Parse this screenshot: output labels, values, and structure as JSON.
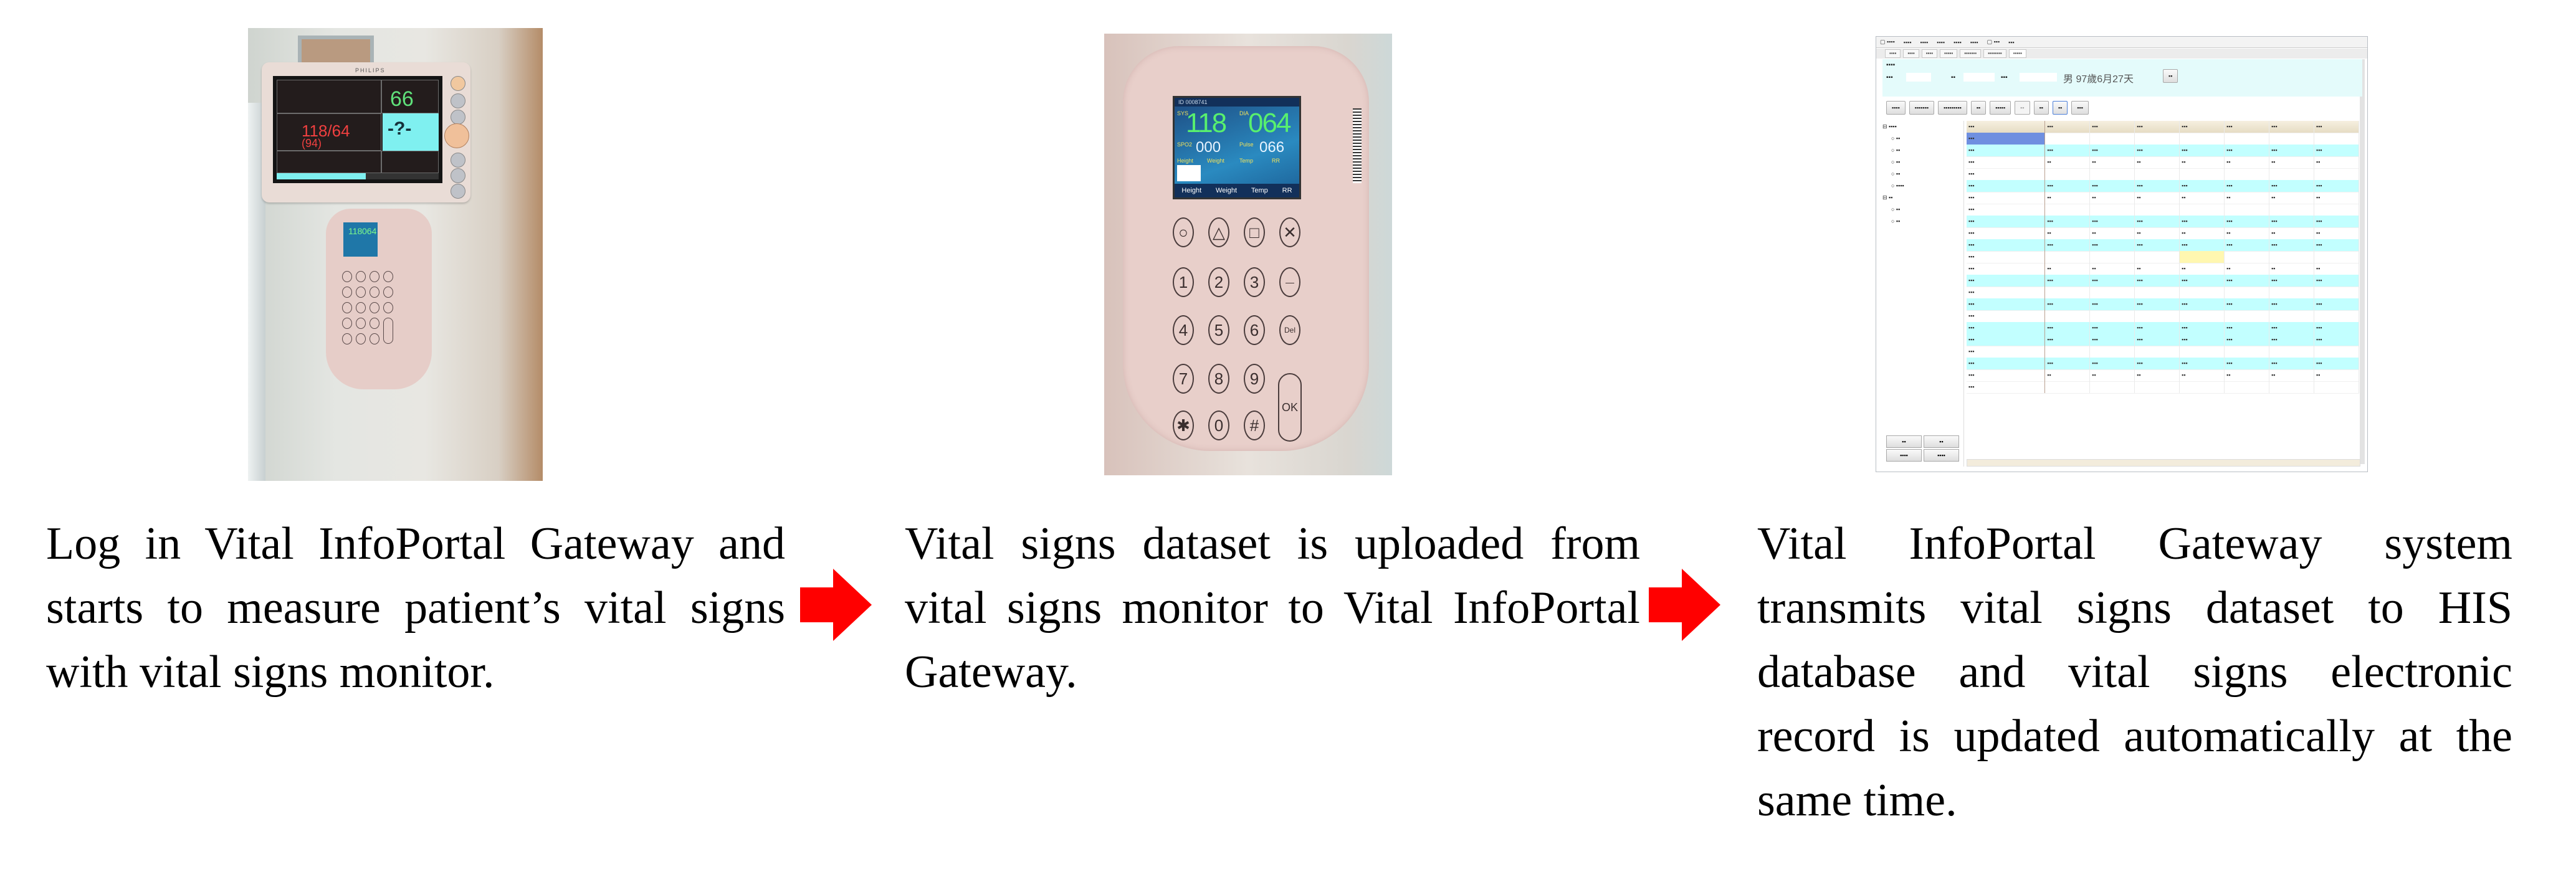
{
  "figure": {
    "steps": [
      {
        "caption": "Log in Vital InfoPortal Gateway and starts to measure patient’s vital signs with vital signs monitor.",
        "image": {
          "kind": "photo",
          "subject": "bedside patient monitor with attached vital signs keypad",
          "monitor": {
            "brand": "PHILIPS",
            "heart_rate": "66",
            "blood_pressure": "118/64",
            "mean_pressure": "(94)",
            "unknown_value": "-?-"
          },
          "keypad_screen": {
            "sys": "118",
            "dia": "064"
          }
        }
      },
      {
        "caption": "Vital signs dataset is uploaded from vital signs monitor to Vital InfoPortal Gateway.",
        "image": {
          "kind": "photo",
          "subject": "vital signs keypad close-up",
          "screen": {
            "header": "ID 0008741",
            "sys_label": "SYS",
            "sys_value": "118",
            "dia_label": "DIA",
            "dia_value": "064",
            "spo2_label": "SPO2",
            "spo2_value": "000",
            "pulse_label": "Pulse",
            "pulse_value": "066",
            "sub_labels": [
              "Height",
              "Weight",
              "Temp",
              "RR"
            ],
            "softkeys": [
              "Height",
              "Weight",
              "Temp",
              "RR"
            ]
          },
          "keys": {
            "function_row": [
              "○",
              "△",
              "□",
              "✕"
            ],
            "rows": [
              [
                "1",
                "2",
                "3",
                "—"
              ],
              [
                "4",
                "5",
                "6",
                "Del"
              ],
              [
                "7",
                "8",
                "9"
              ],
              [
                "✱",
                "0",
                "#"
              ]
            ],
            "ok": "OK"
          }
        }
      },
      {
        "caption": "Vital InfoPortal Gateway system transmits vital signs dataset to HIS database and vital signs electronic record is updated automatically at the same time.",
        "image": {
          "kind": "screenshot",
          "subject": "HIS vital signs electronic record window (illegible CJK text)",
          "info_text": "男 97歲6月27天",
          "highlight_colors": {
            "row_cyan": "#c2ffff",
            "header_blue": "#6f8fe0",
            "cell_yellow": "#fff7b0"
          },
          "grid_rows": 23,
          "grid_value_columns": 7
        }
      }
    ],
    "arrow_color": "#ff0000",
    "arrow_count": 2
  }
}
